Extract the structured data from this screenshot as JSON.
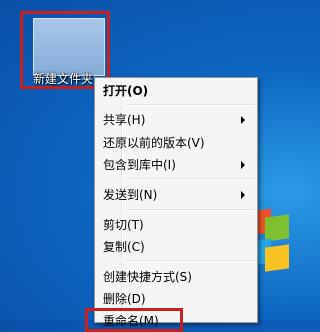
{
  "desktop": {
    "folder": {
      "label": "新建文件夹"
    }
  },
  "context_menu": {
    "items": [
      {
        "label": "打开(O)",
        "bold": true
      },
      {
        "label": "共享(H)",
        "submenu": true
      },
      {
        "label": "还原以前的版本(V)"
      },
      {
        "label": "包含到库中(I)",
        "submenu": true
      },
      {
        "label": "发送到(N)",
        "submenu": true
      },
      {
        "label": "剪切(T)"
      },
      {
        "label": "复制(C)"
      },
      {
        "label": "创建快捷方式(S)"
      },
      {
        "label": "删除(D)"
      },
      {
        "label": "重命名(M)"
      }
    ]
  },
  "colors": {
    "highlight": "#c81f1f",
    "menu_bg": "#f5f5f5",
    "desktop_blue": "#0d67c2"
  }
}
